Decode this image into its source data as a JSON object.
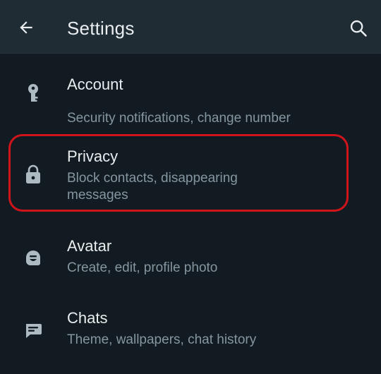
{
  "header": {
    "title": "Settings",
    "back_icon": "arrow-left-icon",
    "search_icon": "search-icon"
  },
  "settings": [
    {
      "id": "account",
      "icon": "key-icon",
      "title": "Account",
      "subtitle": "Security notifications, change number"
    },
    {
      "id": "privacy",
      "icon": "lock-icon",
      "title": "Privacy",
      "subtitle": "Block contacts, disappearing messages"
    },
    {
      "id": "avatar",
      "icon": "avatar-icon",
      "title": "Avatar",
      "subtitle": "Create, edit, profile photo"
    },
    {
      "id": "chats",
      "icon": "chat-icon",
      "title": "Chats",
      "subtitle": "Theme, wallpapers, chat history"
    }
  ],
  "colors": {
    "background": "#111b21",
    "app_bar": "#1f2c34",
    "primary_text": "#e9edef",
    "secondary_text": "#8696a0",
    "icon": "#aebac1",
    "highlight": "#d0141c"
  }
}
